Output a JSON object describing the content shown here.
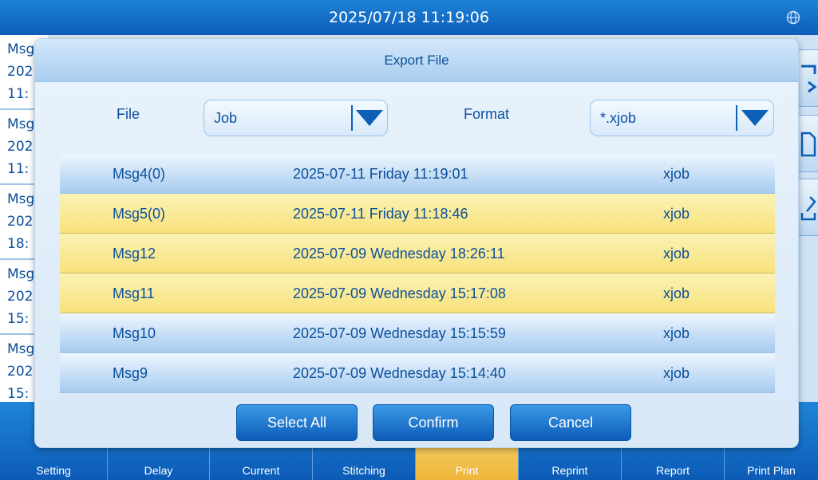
{
  "topbar": {
    "datetime": "2025/07/18 11:19:06",
    "icon": "globe-icon"
  },
  "background_list": {
    "items": [
      {
        "name": "Msg",
        "date": "202",
        "time": "11:"
      },
      {
        "name": "Msg",
        "date": "202",
        "time": "11:"
      },
      {
        "name": "Msg",
        "date": "202",
        "time": "18:"
      },
      {
        "name": "Msg",
        "date": "202",
        "time": "15:"
      },
      {
        "name": "Msg",
        "date": "202",
        "time": "15:"
      }
    ]
  },
  "bottom_nav": {
    "items": [
      {
        "label": "Setting"
      },
      {
        "label": "Delay"
      },
      {
        "label": "Current"
      },
      {
        "label": "Stitching"
      },
      {
        "label": "Print",
        "active": true
      },
      {
        "label": "Reprint"
      },
      {
        "label": "Report"
      },
      {
        "label": "Print Plan"
      }
    ]
  },
  "dialog": {
    "title": "Export File",
    "file_label": "File",
    "file_value": "Job",
    "format_label": "Format",
    "format_value": "*.xjob",
    "rows": [
      {
        "name": "Msg4(0)",
        "datetime": "2025-07-11  Friday  11:19:01",
        "type": "xjob",
        "selected": false
      },
      {
        "name": "Msg5(0)",
        "datetime": "2025-07-11  Friday  11:18:46",
        "type": "xjob",
        "selected": true
      },
      {
        "name": "Msg12",
        "datetime": "2025-07-09  Wednesday  18:26:11",
        "type": "xjob",
        "selected": true
      },
      {
        "name": "Msg11",
        "datetime": "2025-07-09  Wednesday  15:17:08",
        "type": "xjob",
        "selected": true
      },
      {
        "name": "Msg10",
        "datetime": "2025-07-09  Wednesday  15:15:59",
        "type": "xjob",
        "selected": false
      },
      {
        "name": "Msg9",
        "datetime": "2025-07-09  Wednesday  15:14:40",
        "type": "xjob",
        "selected": false
      }
    ],
    "buttons": {
      "select_all": "Select All",
      "confirm": "Confirm",
      "cancel": "Cancel"
    }
  },
  "colors": {
    "primary": "#0d5fb8",
    "selected_row": "#f7e27a",
    "active_nav": "#efb53a"
  }
}
